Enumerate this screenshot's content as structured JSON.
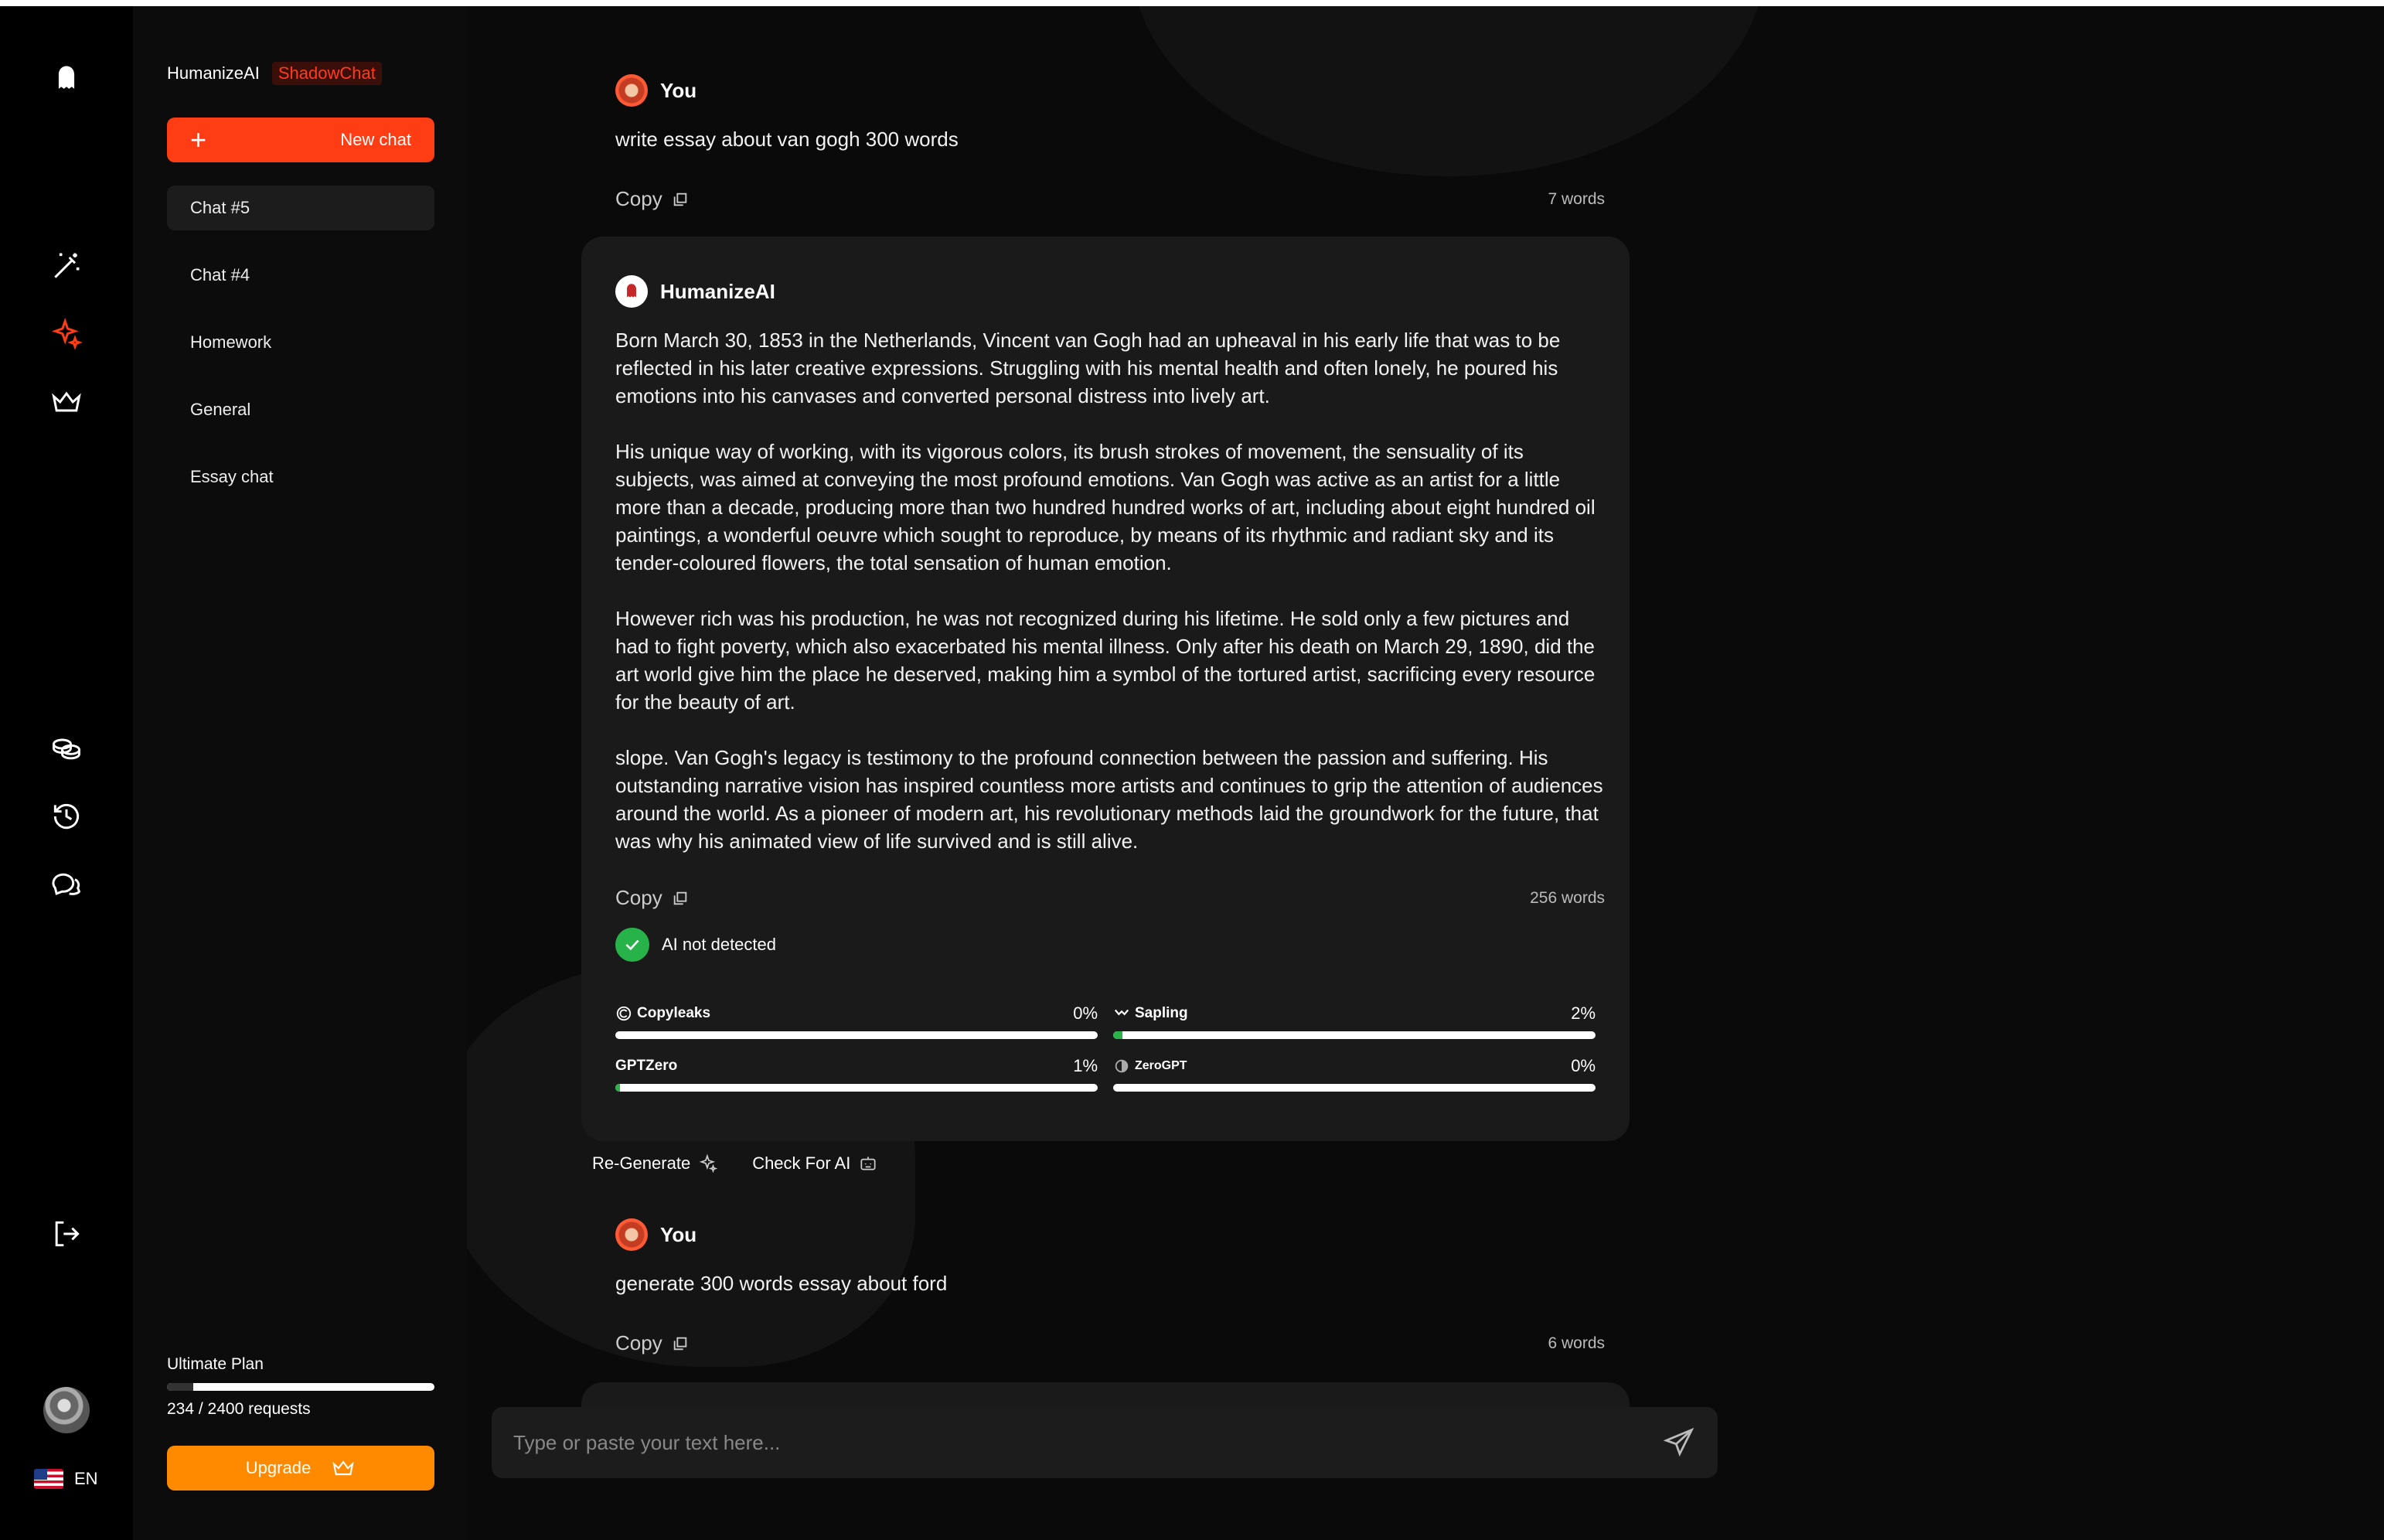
{
  "app": {
    "brand_name": "HumanizeAI",
    "brand_tag": "ShadowChat",
    "accent_color": "#ff3d14",
    "upgrade_color": "#ff8a00",
    "success_color": "#28b34a"
  },
  "rail": {
    "icons": [
      "ghost-logo-icon",
      "magic-wand-icon",
      "sparkle-icon",
      "crown-icon",
      "coins-icon",
      "history-icon",
      "chat-bubbles-icon",
      "logout-icon"
    ],
    "language": "EN"
  },
  "sidebar": {
    "new_chat_label": "New chat",
    "chats": [
      {
        "label": "Chat #5",
        "active": true
      },
      {
        "label": "Chat #4",
        "active": false
      },
      {
        "label": "Homework",
        "active": false
      },
      {
        "label": "General",
        "active": false
      },
      {
        "label": "Essay chat",
        "active": false
      }
    ],
    "plan": {
      "name": "Ultimate Plan",
      "requests_text": "234 / 2400 requests",
      "used_fraction": 0.0975
    },
    "upgrade_label": "Upgrade"
  },
  "messages": [
    {
      "author": "You",
      "text": "write essay about van gogh 300 words",
      "copy_label": "Copy",
      "word_count": "7 words"
    },
    {
      "author": "HumanizeAI",
      "paragraphs": [
        "Born March 30, 1853 in the Netherlands, Vincent van Gogh had an upheaval in his early life that was to be reflected in his later creative expressions. Struggling with his mental health and often lonely, he poured his emotions into his canvases and converted personal distress into lively art.",
        "His unique way of working, with its vigorous colors, its brush strokes of movement, the sensuality of its subjects, was aimed at conveying the most profound emotions. Van Gogh was active as an artist for a little more than a decade, producing more than two hundred hundred works of art, including about eight hundred oil paintings, a wonderful oeuvre which sought to reproduce, by means of its rhythmic and radiant sky and its tender-coloured flowers, the total sensation of human emotion.",
        "However rich was his production, he was not recognized during his lifetime. He sold only a few pictures and had to fight poverty, which also exacerbated his mental illness. Only after his death on March 29, 1890, did the art world give him the place he deserved, making him a symbol of the tortured artist, sacrificing every resource for the beauty of art.",
        "slope. Van Gogh's legacy is testimony to the profound connection between the passion and suffering. His outstanding narrative vision has inspired countless more artists and continues to grip the attention of audiences around the world. As a pioneer of modern art, his revolutionary methods laid the groundwork for the future, that was why his animated view of life survived and is still alive."
      ],
      "copy_label": "Copy",
      "word_count": "256 words",
      "detection_label": "AI not detected",
      "detectors": [
        {
          "name": "Copyleaks",
          "pct_text": "0%",
          "value": 0
        },
        {
          "name": "Sapling",
          "pct_text": "2%",
          "value": 2
        },
        {
          "name": "GPTZero",
          "pct_text": "1%",
          "value": 1
        },
        {
          "name": "ZeroGPT",
          "pct_text": "0%",
          "value": 0
        }
      ],
      "actions": {
        "regenerate": "Re-Generate",
        "check_ai": "Check For AI"
      }
    },
    {
      "author": "You",
      "text": "generate 300 words essay about ford",
      "copy_label": "Copy",
      "word_count": "6 words"
    }
  ],
  "composer": {
    "placeholder": "Type or paste your text here..."
  }
}
